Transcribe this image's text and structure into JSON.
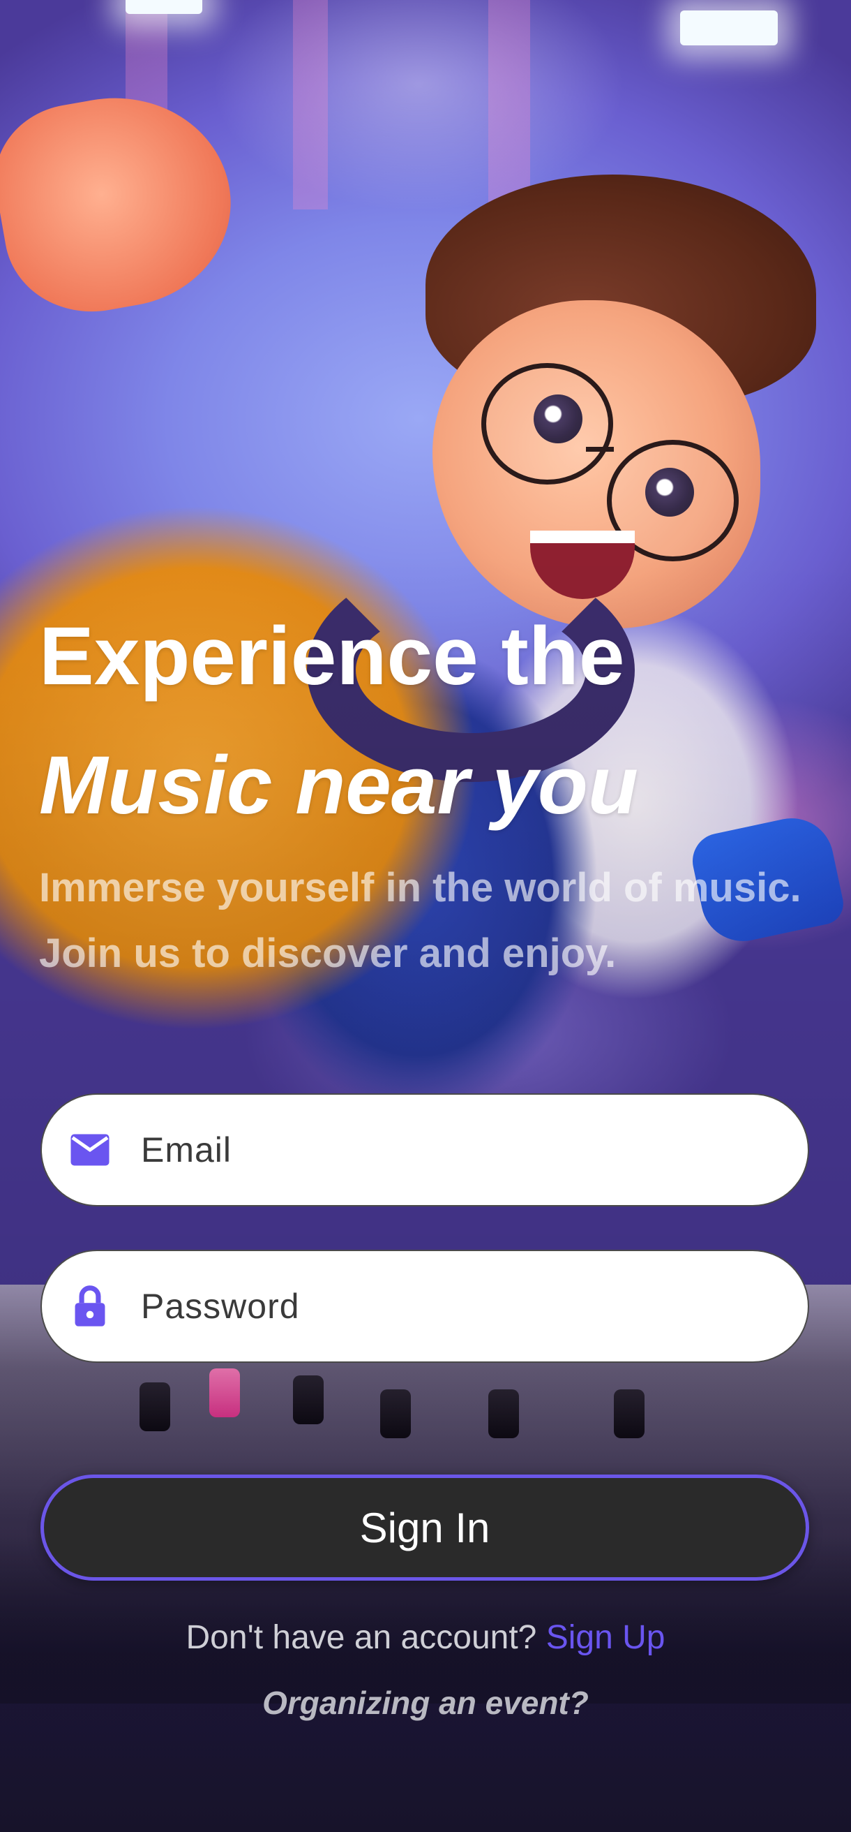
{
  "hero": {
    "title_line1": "Experience the",
    "title_line2": "Music near you",
    "subtitle": "Immerse yourself in the world of music. Join us to discover and enjoy."
  },
  "form": {
    "email": {
      "placeholder": "Email",
      "value": "",
      "icon": "mail-icon"
    },
    "password": {
      "placeholder": "Password",
      "value": "",
      "icon": "lock-icon"
    },
    "sign_in_label": "Sign In"
  },
  "footer": {
    "signup_prompt": "Don't have an account?",
    "signup_link": "Sign Up",
    "organizer_link": "Organizing an event?"
  },
  "colors": {
    "accent": "#6a55f0",
    "button_bg": "#2a2a2a",
    "field_bg": "#ffffff"
  }
}
